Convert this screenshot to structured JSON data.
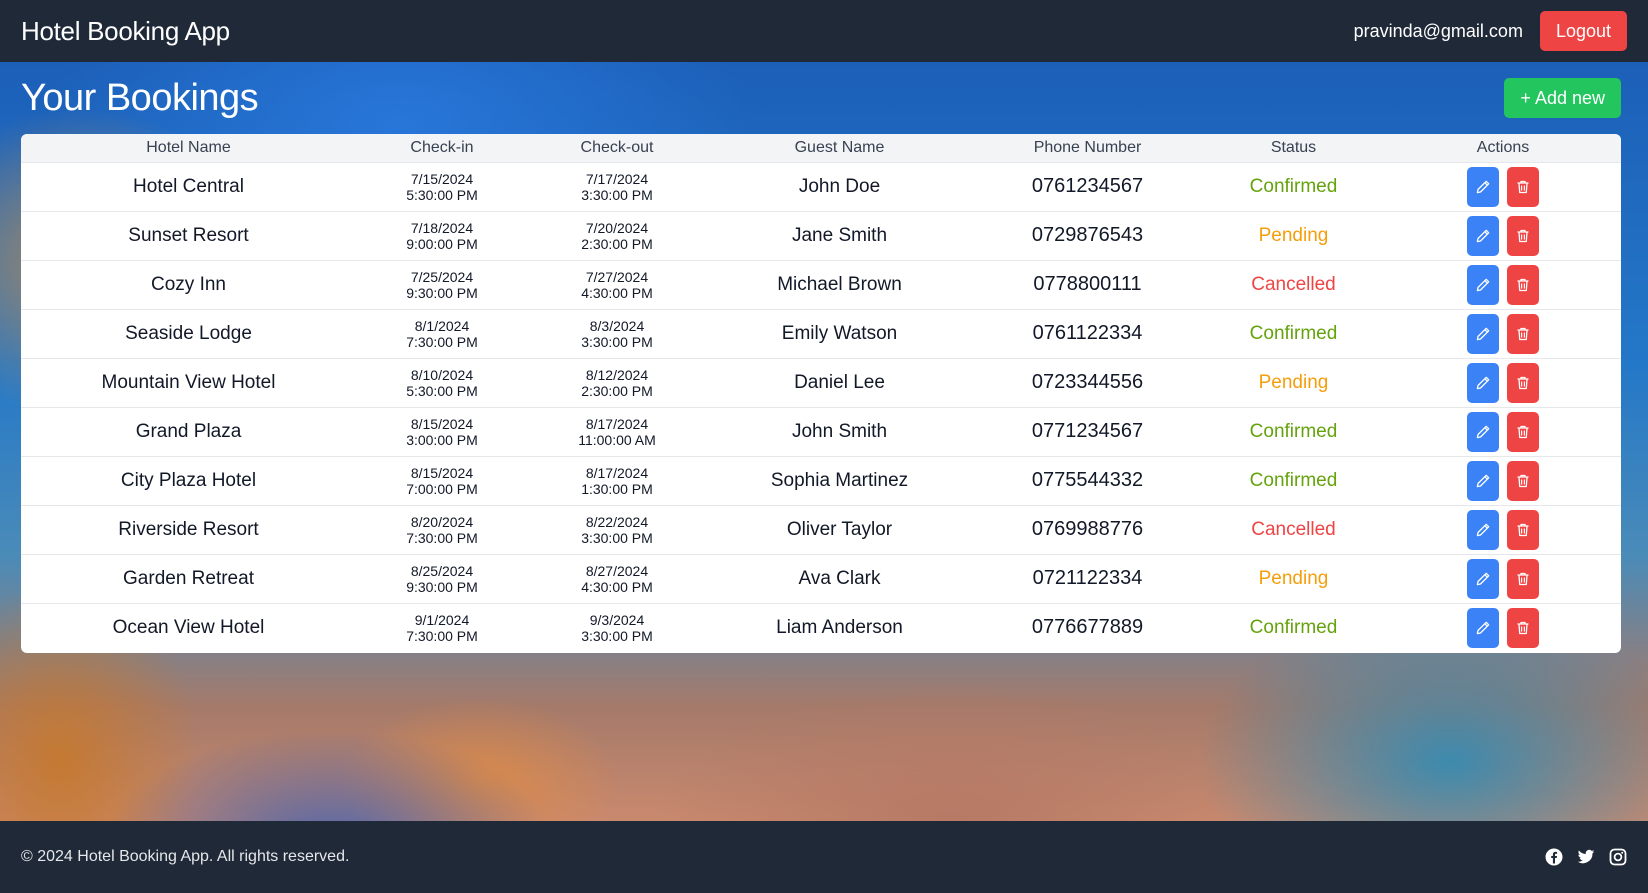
{
  "nav": {
    "brand": "Hotel Booking App",
    "user_email": "pravinda@gmail.com",
    "logout_label": "Logout"
  },
  "page": {
    "title": "Your Bookings",
    "add_label": "+ Add new"
  },
  "table": {
    "headers": [
      "Hotel Name",
      "Check-in",
      "Check-out",
      "Guest Name",
      "Phone Number",
      "Status",
      "Actions"
    ],
    "rows": [
      {
        "hotel": "Hotel Central",
        "checkin_date": "7/15/2024",
        "checkin_time": "5:30:00 PM",
        "checkout_date": "7/17/2024",
        "checkout_time": "3:30:00 PM",
        "guest": "John Doe",
        "phone": "0761234567",
        "status": "Confirmed"
      },
      {
        "hotel": "Sunset Resort",
        "checkin_date": "7/18/2024",
        "checkin_time": "9:00:00 PM",
        "checkout_date": "7/20/2024",
        "checkout_time": "2:30:00 PM",
        "guest": "Jane Smith",
        "phone": "0729876543",
        "status": "Pending"
      },
      {
        "hotel": "Cozy Inn",
        "checkin_date": "7/25/2024",
        "checkin_time": "9:30:00 PM",
        "checkout_date": "7/27/2024",
        "checkout_time": "4:30:00 PM",
        "guest": "Michael Brown",
        "phone": "0778800111",
        "status": "Cancelled"
      },
      {
        "hotel": "Seaside Lodge",
        "checkin_date": "8/1/2024",
        "checkin_time": "7:30:00 PM",
        "checkout_date": "8/3/2024",
        "checkout_time": "3:30:00 PM",
        "guest": "Emily Watson",
        "phone": "0761122334",
        "status": "Confirmed"
      },
      {
        "hotel": "Mountain View Hotel",
        "checkin_date": "8/10/2024",
        "checkin_time": "5:30:00 PM",
        "checkout_date": "8/12/2024",
        "checkout_time": "2:30:00 PM",
        "guest": "Daniel Lee",
        "phone": "0723344556",
        "status": "Pending"
      },
      {
        "hotel": "Grand Plaza",
        "checkin_date": "8/15/2024",
        "checkin_time": "3:00:00 PM",
        "checkout_date": "8/17/2024",
        "checkout_time": "11:00:00 AM",
        "guest": "John Smith",
        "phone": "0771234567",
        "status": "Confirmed"
      },
      {
        "hotel": "City Plaza Hotel",
        "checkin_date": "8/15/2024",
        "checkin_time": "7:00:00 PM",
        "checkout_date": "8/17/2024",
        "checkout_time": "1:30:00 PM",
        "guest": "Sophia Martinez",
        "phone": "0775544332",
        "status": "Confirmed"
      },
      {
        "hotel": "Riverside Resort",
        "checkin_date": "8/20/2024",
        "checkin_time": "7:30:00 PM",
        "checkout_date": "8/22/2024",
        "checkout_time": "3:30:00 PM",
        "guest": "Oliver Taylor",
        "phone": "0769988776",
        "status": "Cancelled"
      },
      {
        "hotel": "Garden Retreat",
        "checkin_date": "8/25/2024",
        "checkin_time": "9:30:00 PM",
        "checkout_date": "8/27/2024",
        "checkout_time": "4:30:00 PM",
        "guest": "Ava Clark",
        "phone": "0721122334",
        "status": "Pending"
      },
      {
        "hotel": "Ocean View Hotel",
        "checkin_date": "9/1/2024",
        "checkin_time": "7:30:00 PM",
        "checkout_date": "9/3/2024",
        "checkout_time": "3:30:00 PM",
        "guest": "Liam Anderson",
        "phone": "0776677889",
        "status": "Confirmed"
      }
    ],
    "row_icons": {
      "edit": "pencil-icon",
      "delete": "trash-icon"
    }
  },
  "status_colors": {
    "Confirmed": "#65a30d",
    "Pending": "#f59e0b",
    "Cancelled": "#ef4444"
  },
  "colors": {
    "nav_bg": "#1f2937",
    "logout": "#ef4444",
    "add": "#22c55e",
    "edit": "#3b82f6",
    "delete": "#ef4444"
  },
  "footer": {
    "copyright": "© 2024 Hotel Booking App. All rights reserved.",
    "social_icons": [
      "facebook-icon",
      "twitter-icon",
      "instagram-icon"
    ]
  }
}
